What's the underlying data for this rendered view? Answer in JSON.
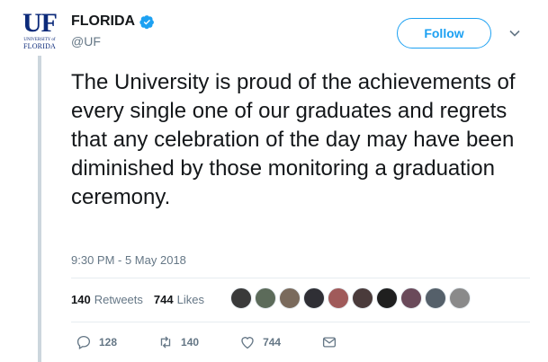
{
  "account": {
    "display_name": "FLORIDA",
    "handle": "@UF",
    "logo_text": "UF",
    "logo_line1": "UNIVERSITY of",
    "logo_line2": "FLORIDA",
    "verified_icon": "verified-badge-icon"
  },
  "follow_button": {
    "label": "Follow"
  },
  "tweet": {
    "text": "The University is proud of the achievements of every single one of our graduates and regrets that any celebration of the day may have been diminished by those monitoring a graduation ceremony.",
    "timestamp": "9:30 PM - 5 May 2018"
  },
  "stats": {
    "retweets_count": "140",
    "retweets_label": "Retweets",
    "likes_count": "744",
    "likes_label": "Likes"
  },
  "actions": {
    "reply_count": "128",
    "retweet_count": "140",
    "like_count": "744"
  },
  "colors": {
    "accent": "#1da1f2",
    "brand_blue": "#0c2a7a",
    "muted": "#657786",
    "thread_line": "#ccd6dd"
  },
  "likers": [
    "#3a3a3a",
    "#5c6b5a",
    "#7a6a5c",
    "#2f2f35",
    "#a05a5a",
    "#4a3b3b",
    "#1f1f1f",
    "#6a4a5a",
    "#55606a",
    "#8a8a8a"
  ]
}
